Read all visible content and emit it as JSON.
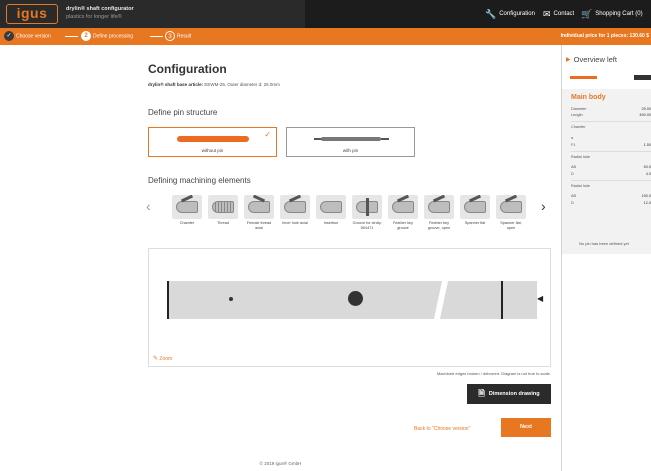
{
  "header": {
    "logo_text": "igus",
    "app_title": "drylin® shaft configurator",
    "app_subtitle": "plastics for longer life®",
    "nav": [
      {
        "icon": "wrench-icon",
        "label": "Configuration"
      },
      {
        "icon": "mail-icon",
        "label": "Contact"
      },
      {
        "icon": "cart-icon",
        "label": "Shopping Cart (0)"
      }
    ]
  },
  "steps": [
    {
      "number": "1",
      "label": "Choose version",
      "state": "done"
    },
    {
      "number": "2",
      "label": "Define processing",
      "state": "current"
    },
    {
      "number": "3",
      "label": "Result",
      "state": "upcoming"
    }
  ],
  "price_text": "Individual price for 1 pieces: 130.60 $",
  "main": {
    "title": "Configuration",
    "article_label": "drylin® shaft base article:",
    "article_value": "EEWM-25, Outer diameter d: 25.0mm",
    "pin_heading": "Define pin structure",
    "pin_options": [
      {
        "label": "without pin",
        "selected": true
      },
      {
        "label": "with pin",
        "selected": false
      }
    ],
    "machining_heading": "Defining machining elements",
    "machining_elements": [
      "Chamfer",
      "Thread",
      "Female thread axial",
      "Inner hole axial",
      "Insertion",
      "Groove for circlip DIN471",
      "Feather key groove",
      "Feather key groove, open",
      "Spanner flat",
      "Spanner flat, open"
    ],
    "zoom_label": "Zoom",
    "diagram_note": "Machined edges broken / deburred. Diagram is not true to scale.",
    "dimension_button": "Dimension drawing",
    "back_link": "Back to \"Choose version\"",
    "next_button": "Next",
    "footer": "© 2019 igus® GmbH"
  },
  "panel": {
    "title": "Overview left",
    "section_title": "Main body",
    "rows": [
      {
        "key": "Diameter",
        "value": "25.00"
      },
      {
        "key": "Length",
        "value": "450.00"
      }
    ],
    "chamfer_title": "Chamfer",
    "chamfer_rows": [
      {
        "key": "α",
        "value": ""
      },
      {
        "key": "F1",
        "value": "1.50"
      }
    ],
    "radial1_title": "Radial hole",
    "radial1_rows": [
      {
        "key": "AB",
        "value": "50.0"
      },
      {
        "key": "D",
        "value": "4.0"
      }
    ],
    "radial2_title": "Radial hole",
    "radial2_rows": [
      {
        "key": "AB",
        "value": "150.0"
      },
      {
        "key": "D",
        "value": "12.0"
      }
    ],
    "note": "No pin has been defined yet"
  },
  "colors": {
    "brand_orange": "#e87722",
    "topbar": "#2a2a2a"
  }
}
